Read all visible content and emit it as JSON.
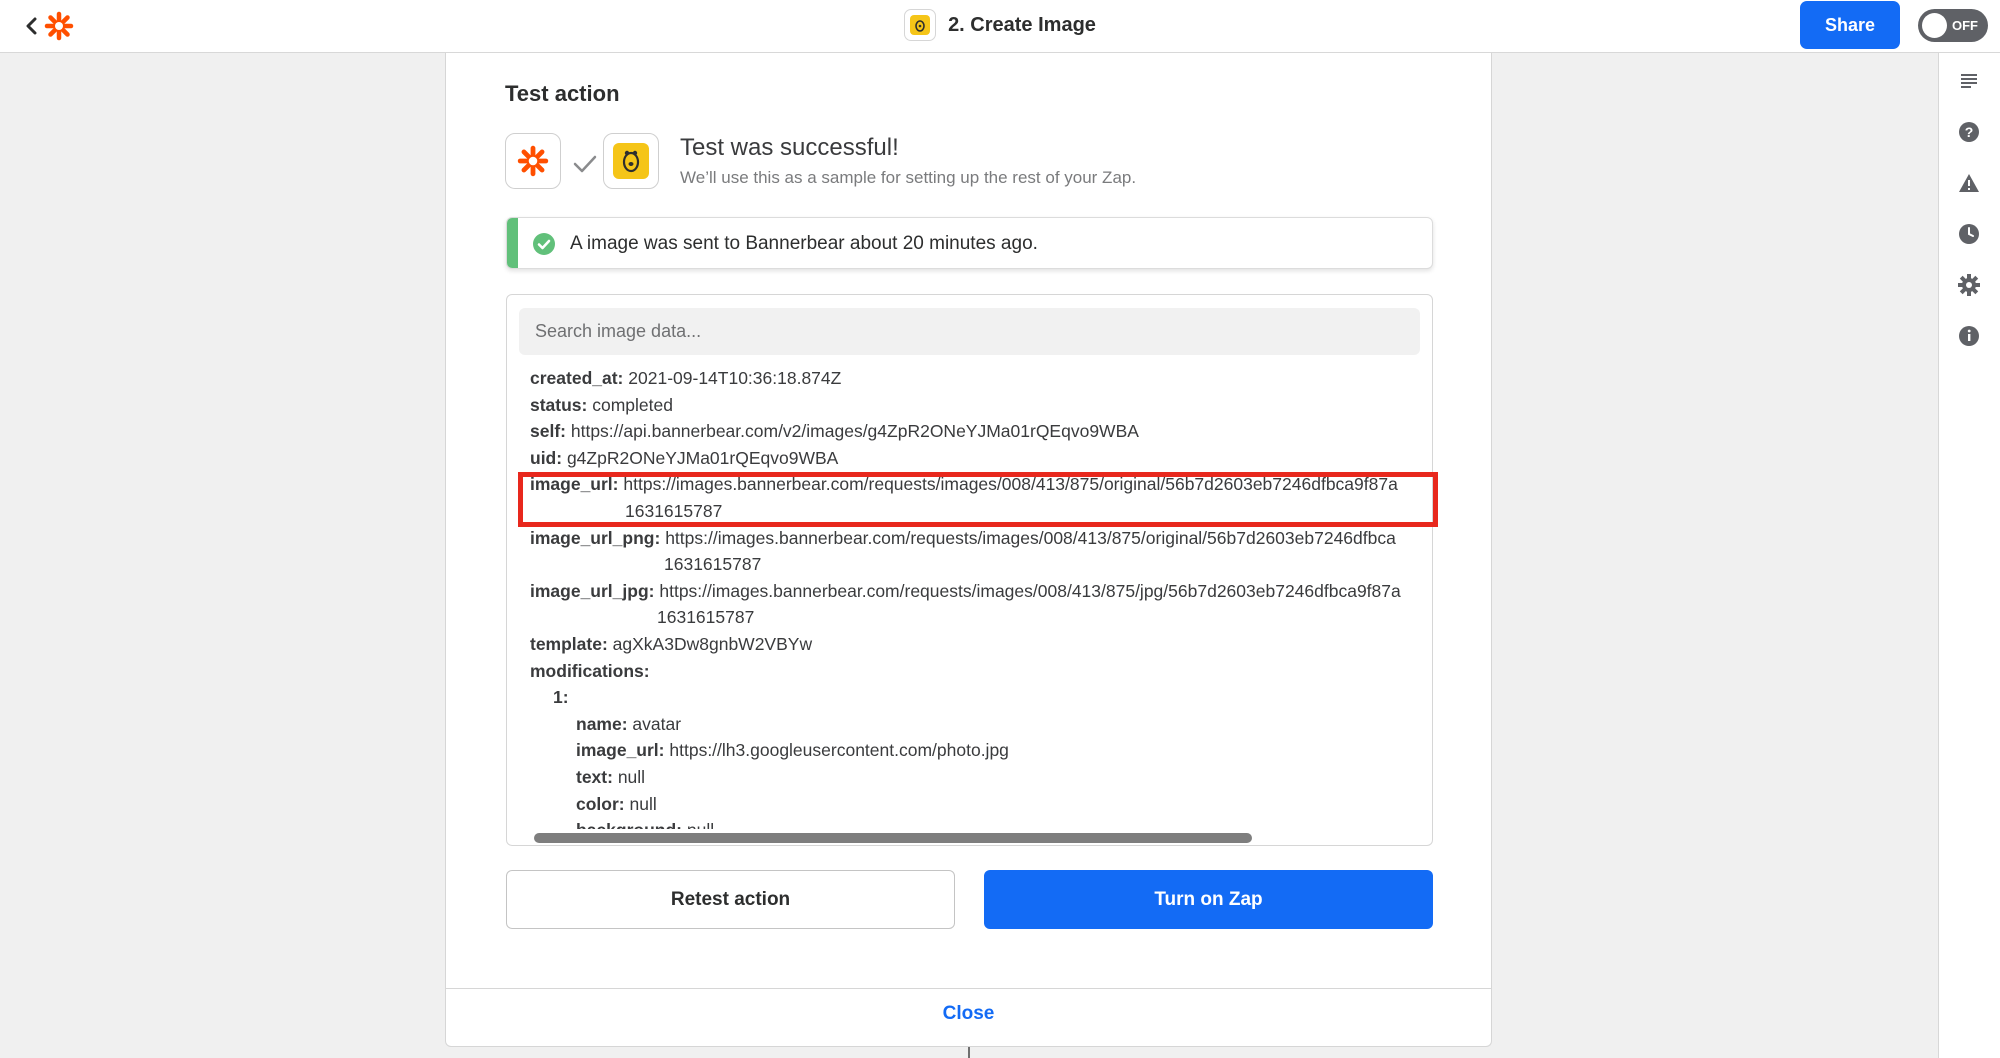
{
  "header": {
    "title": "2. Create Image",
    "share_label": "Share",
    "toggle_label": "OFF"
  },
  "test_action": {
    "heading": "Test action",
    "success_title": "Test was successful!",
    "success_subtitle": "We’ll use this as a sample for setting up the rest of your Zap.",
    "alert_text": "A image was sent to Bannerbear about 20 minutes ago."
  },
  "search": {
    "placeholder": "Search image data..."
  },
  "data_rows": [
    {
      "key": "created_at:",
      "value": "2021-09-14T10:36:18.874Z"
    },
    {
      "key": "status:",
      "value": "completed"
    },
    {
      "key": "self:",
      "value": "https://api.bannerbear.com/v2/images/g4ZpR2ONeYJMa01rQEqvo9WBA"
    },
    {
      "key": "uid:",
      "value": "g4ZpR2ONeYJMa01rQEqvo9WBA"
    },
    {
      "key": "image_url:",
      "value": "https://images.bannerbear.com/requests/images/008/413/875/original/56b7d2603eb7246dfbca9f87a",
      "cont": "1631615787"
    },
    {
      "key": "image_url_png:",
      "value": "https://images.bannerbear.com/requests/images/008/413/875/original/56b7d2603eb7246dfbca",
      "cont": "1631615787"
    },
    {
      "key": "image_url_jpg:",
      "value": "https://images.bannerbear.com/requests/images/008/413/875/jpg/56b7d2603eb7246dfbca9f87a",
      "cont": "1631615787"
    },
    {
      "key": "template:",
      "value": "agXkA3Dw8gnbW2VBYw"
    },
    {
      "key": "modifications:",
      "value": ""
    },
    {
      "key": "1:",
      "value": ""
    },
    {
      "key": "name:",
      "value": "avatar"
    },
    {
      "key": "image_url:",
      "value": "https://lh3.googleusercontent.com/photo.jpg"
    },
    {
      "key": "text:",
      "value": "null"
    },
    {
      "key": "color:",
      "value": "null"
    },
    {
      "key": "background:",
      "value": "null"
    }
  ],
  "buttons": {
    "retest": "Retest action",
    "turn_on": "Turn on Zap",
    "close": "Close"
  },
  "sidebar_icons": [
    "notes-icon",
    "help-icon",
    "warning-icon",
    "history-icon",
    "settings-icon",
    "info-icon"
  ],
  "colors": {
    "brand_orange": "#ff4f00",
    "primary_blue": "#136bf5",
    "success_green": "#61c07a",
    "highlight_red": "#e8281d",
    "bannerbear_yellow": "#f5c518"
  }
}
